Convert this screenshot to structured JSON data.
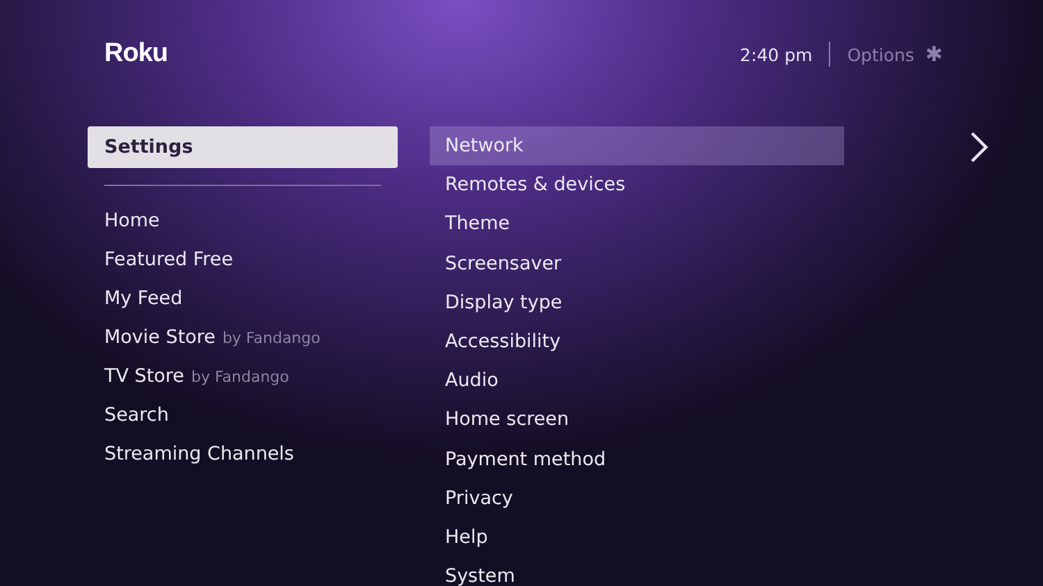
{
  "header": {
    "logo": "Roku",
    "time": "2:40 pm",
    "options": "Options",
    "options_icon": "✱"
  },
  "nav": [
    {
      "label": "Settings",
      "selected": true
    },
    {
      "label": "Home",
      "selected": false
    },
    {
      "label": "Featured Free",
      "selected": false
    },
    {
      "label": "My Feed",
      "selected": false
    },
    {
      "label": "Movie Store",
      "suffix": "by Fandango",
      "selected": false
    },
    {
      "label": "TV Store",
      "suffix": "by Fandango",
      "selected": false
    },
    {
      "label": "Search",
      "selected": false
    },
    {
      "label": "Streaming Channels",
      "selected": false
    }
  ],
  "settings": [
    {
      "label": "Network",
      "selected": true
    },
    {
      "label": "Remotes & devices",
      "selected": false
    },
    {
      "label": "Theme",
      "selected": false
    },
    {
      "label": "Screensaver",
      "selected": false
    },
    {
      "label": "Display type",
      "selected": false
    },
    {
      "label": "Accessibility",
      "selected": false
    },
    {
      "label": "Audio",
      "selected": false
    },
    {
      "label": "Home screen",
      "selected": false
    },
    {
      "label": "Payment method",
      "selected": false
    },
    {
      "label": "Privacy",
      "selected": false
    },
    {
      "label": "Help",
      "selected": false
    },
    {
      "label": "System",
      "selected": false
    }
  ]
}
